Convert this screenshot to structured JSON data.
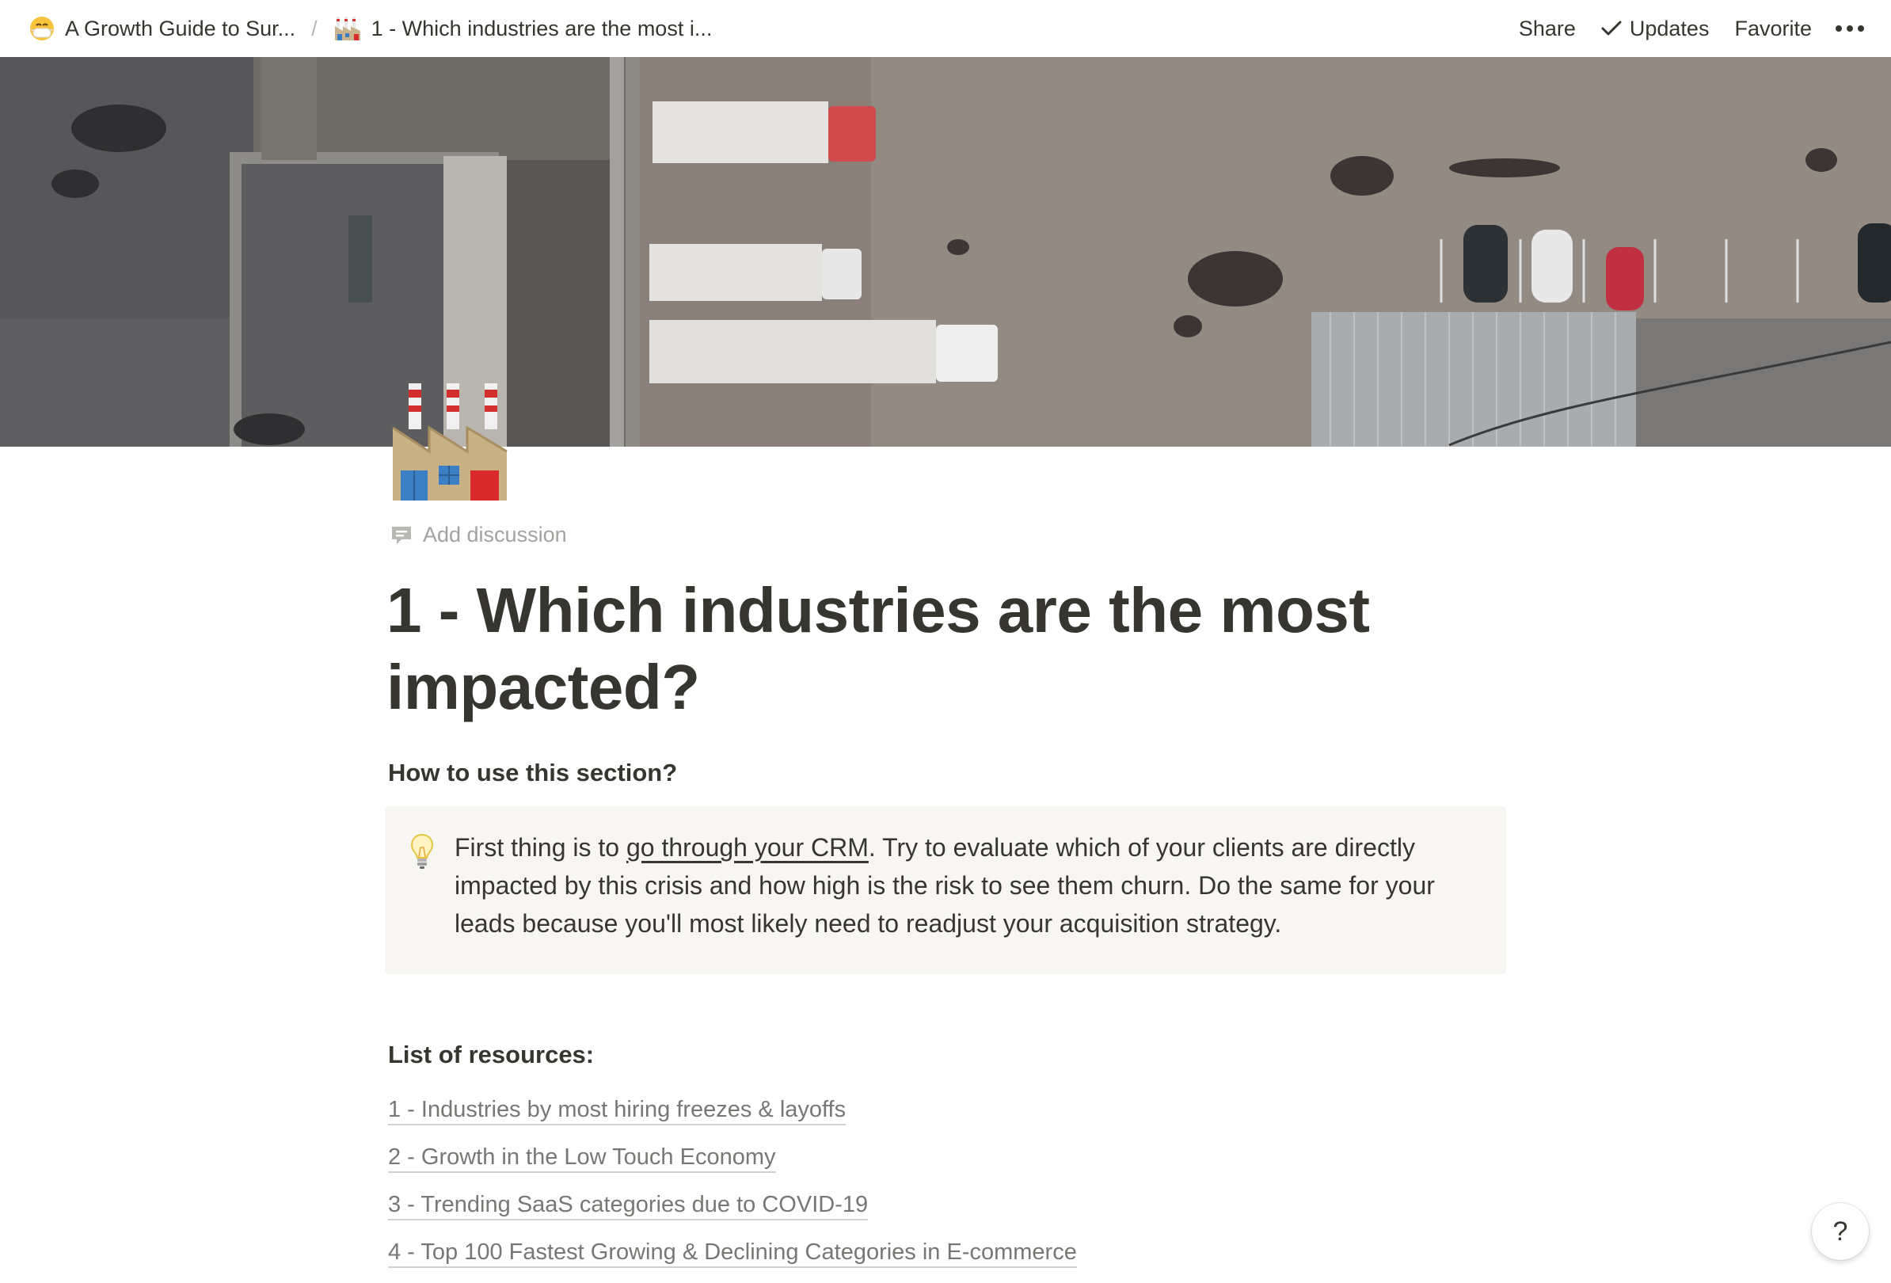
{
  "topbar": {
    "breadcrumbs": [
      {
        "icon": "mask-face-emoji",
        "label": "A Growth Guide to Sur..."
      },
      {
        "icon": "factory-emoji",
        "label": "1 - Which industries are the most i..."
      }
    ],
    "separator": "/",
    "share_label": "Share",
    "updates_label": "Updates",
    "favorite_label": "Favorite",
    "more_icon": "more-horizontal-icon"
  },
  "cover": {
    "description_icon": "aerial-warehouse-photo"
  },
  "page": {
    "icon": "factory-emoji",
    "add_discussion_label": "Add discussion",
    "title": "1 - Which industries are the most impacted?",
    "how_to_heading": "How to use this section?",
    "callout": {
      "icon": "light-bulb-icon",
      "text_before": "First thing is to ",
      "link_text": "go through your CRM",
      "text_after": ". Try to evaluate which of your clients are directly impacted by this crisis and how high is the risk to see them churn. Do the same for your leads because you'll most likely need to readjust your acquisition strategy."
    },
    "resources_heading": "List of resources:",
    "resources": [
      "1 - Industries by most hiring freezes & layoffs",
      "2 - Growth in the Low Touch Economy",
      "3 - Trending SaaS categories due to COVID-19",
      "4 - Top 100 Fastest Growing & Declining Categories in E-commerce"
    ]
  },
  "help": {
    "label": "?"
  },
  "colors": {
    "text": "#37352f",
    "muted": "#787774",
    "callout_bg": "#f7f6f3",
    "underline": "#d3d2cf"
  }
}
